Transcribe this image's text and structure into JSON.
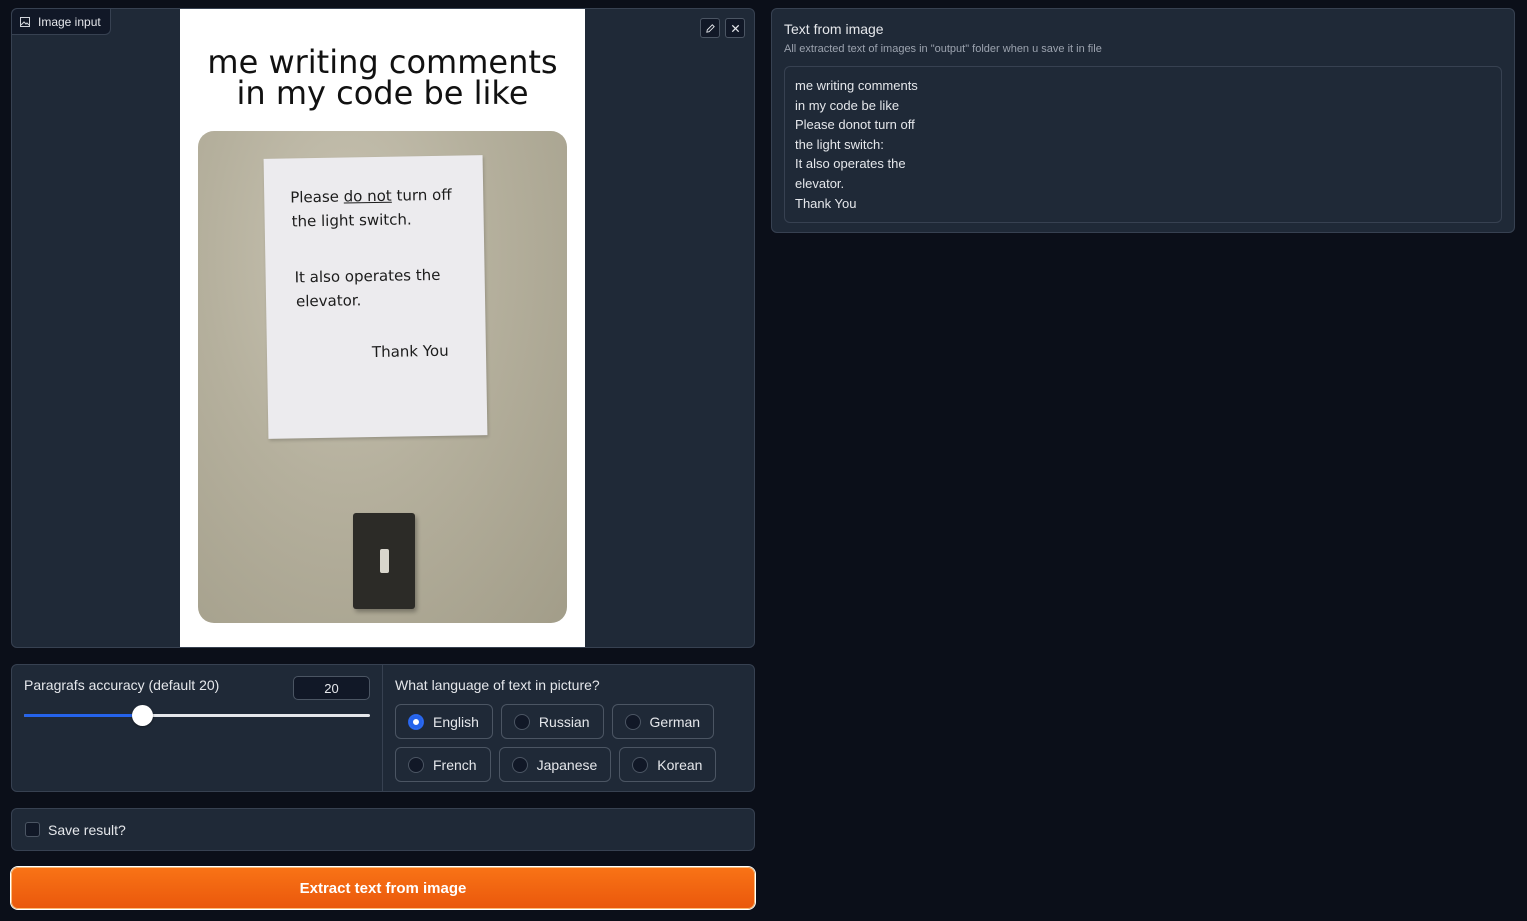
{
  "image_input": {
    "label": "Image input",
    "edit_icon": "pencil-icon",
    "close_icon": "close-icon",
    "meme": {
      "caption_line1": "me writing comments",
      "caption_line2": "in my code be like",
      "note": {
        "line1_pre": "Please ",
        "line1_underlined": "do not",
        "line1_post": " turn off",
        "line2": "the light switch.",
        "line3": "It also operates the",
        "line4": "elevator.",
        "line5": "Thank You"
      }
    }
  },
  "paragraph_accuracy": {
    "label": "Paragrafs accuracy (default 20)",
    "value": "20",
    "fraction": 0.34
  },
  "language": {
    "label": "What language of text in picture?",
    "selected": "English",
    "options": [
      "English",
      "Russian",
      "German",
      "French",
      "Japanese",
      "Korean"
    ]
  },
  "save": {
    "label": "Save result?",
    "checked": false
  },
  "extract_button": {
    "label": "Extract text from image"
  },
  "output": {
    "title": "Text from image",
    "info": "All extracted text of images in \"output\" folder when u save it in file",
    "lines": [
      "me writing comments",
      "in my code be like",
      "Please donot turn off",
      "the light switch:",
      "It also operates the",
      "elevator.",
      "Thank You"
    ]
  },
  "colors": {
    "background": "#0b0f19",
    "panel": "#1f2937",
    "accent_blue": "#2563eb",
    "button_orange": "#f97316"
  }
}
